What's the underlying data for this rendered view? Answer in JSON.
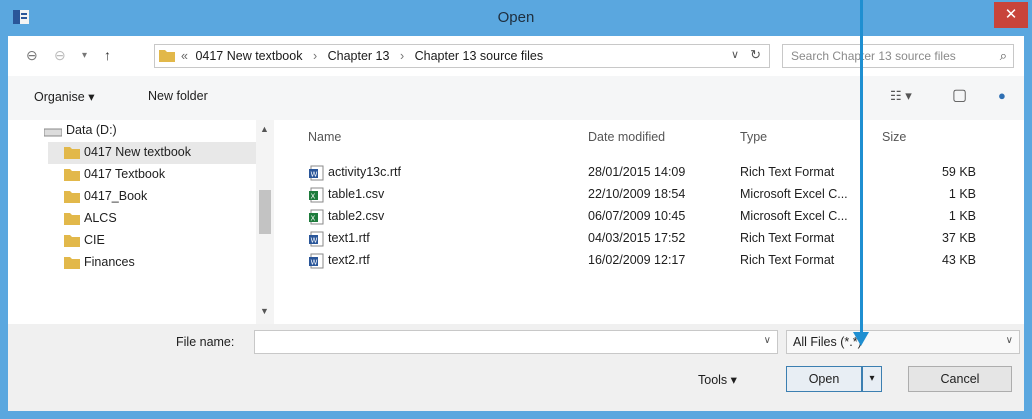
{
  "window": {
    "title": "Open",
    "close_glyph": "✕",
    "app_icon": "dialog-app-icon"
  },
  "nav": {
    "back_glyph": "⊖",
    "forward_glyph": "⊖",
    "recent_glyph": "▾",
    "up_glyph": "↑"
  },
  "address": {
    "prefix": "«",
    "crumbs": [
      "0417 New textbook",
      "Chapter 13",
      "Chapter 13 source files"
    ],
    "separator": "›",
    "dropdown_glyph": "∨",
    "refresh_glyph": "↻"
  },
  "search": {
    "placeholder": "Search Chapter 13 source files",
    "icon_glyph": "⌕"
  },
  "toolbar": {
    "organise_label": "Organise ▾",
    "new_folder_label": "New folder",
    "view_glyph": "☷ ▾",
    "preview_glyph": "▢",
    "help_glyph": "●"
  },
  "nav_pane": {
    "drive_label": "Data (D:)",
    "items": [
      {
        "label": "0417 New textbook",
        "selected": true
      },
      {
        "label": "0417 Textbook",
        "selected": false
      },
      {
        "label": "0417_Book",
        "selected": false
      },
      {
        "label": "ALCS",
        "selected": false
      },
      {
        "label": "CIE",
        "selected": false
      },
      {
        "label": "Finances",
        "selected": false
      }
    ],
    "scroll_up_glyph": "▲",
    "scroll_down_glyph": "▼"
  },
  "file_list": {
    "columns": {
      "name": "Name",
      "date": "Date modified",
      "type": "Type",
      "size": "Size"
    },
    "files": [
      {
        "name": "activity13c.rtf",
        "date": "28/01/2015 14:09",
        "type": "Rich Text Format",
        "size": "59 KB",
        "kind": "rtf"
      },
      {
        "name": "table1.csv",
        "date": "22/10/2009 18:54",
        "type": "Microsoft Excel C...",
        "size": "1 KB",
        "kind": "csv"
      },
      {
        "name": "table2.csv",
        "date": "06/07/2009 10:45",
        "type": "Microsoft Excel C...",
        "size": "1 KB",
        "kind": "csv"
      },
      {
        "name": "text1.rtf",
        "date": "04/03/2015 17:52",
        "type": "Rich Text Format",
        "size": "37 KB",
        "kind": "rtf"
      },
      {
        "name": "text2.rtf",
        "date": "16/02/2009 12:17",
        "type": "Rich Text Format",
        "size": "43 KB",
        "kind": "rtf"
      }
    ]
  },
  "bottom": {
    "file_name_label": "File name:",
    "file_name_value": "",
    "dropdown_glyph": "∨",
    "filter_value": "All Files (*.*)",
    "tools_label": "Tools ▾",
    "open_label": "Open",
    "split_glyph": "▾",
    "cancel_label": "Cancel"
  },
  "colors": {
    "titlebar": "#5aa7df",
    "close": "#c8443b",
    "pointer_arrow": "#1f8fd1",
    "folder": "#e2b84a",
    "excel": "#1e7b3c",
    "word": "#2a5699"
  }
}
